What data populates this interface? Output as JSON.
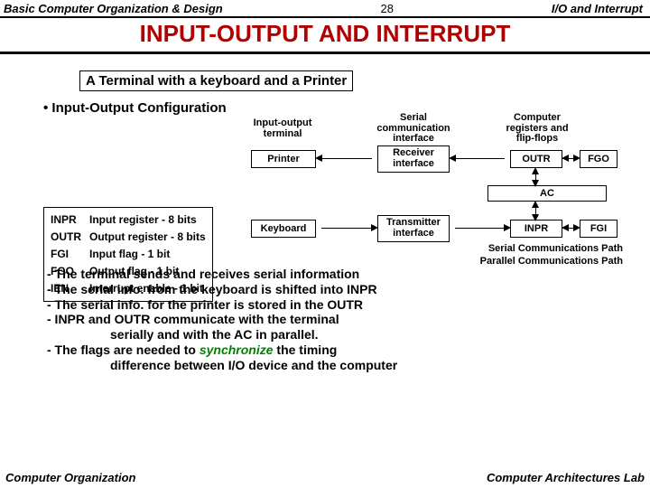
{
  "header": {
    "left": "Basic Computer Organization & Design",
    "num": "28",
    "right": "I/O and Interrupt"
  },
  "title": "INPUT-OUTPUT  AND  INTERRUPT",
  "subtitle": "A Terminal with a keyboard and a Printer",
  "bullet": "• Input-Output Configuration",
  "col_labels": {
    "io_terminal": "Input-output\nterminal",
    "serial_if": "Serial\ncommunication\ninterface",
    "regs": "Computer\nregisters and\nflip-flops"
  },
  "boxes": {
    "printer": "Printer",
    "keyboard": "Keyboard",
    "receiver_if": "Receiver\ninterface",
    "transmitter_if": "Transmitter\ninterface",
    "outr": "OUTR",
    "inpr": "INPR",
    "fgo": "FGO",
    "fgi": "FGI",
    "ac": "AC"
  },
  "reg_table": [
    [
      "INPR",
      "Input register - 8 bits"
    ],
    [
      "OUTR",
      "Output register - 8 bits"
    ],
    [
      "FGI",
      "Input flag - 1 bit"
    ],
    [
      "FGO",
      "Output flag - 1 bit"
    ],
    [
      "IEN",
      "Interrupt enable - 1 bit"
    ]
  ],
  "paths": {
    "serial": "Serial Communications Path",
    "parallel": "Parallel Communications Path"
  },
  "notes": {
    "l1": "- The terminal sends and receives serial information",
    "l2": "- The serial info. from the keyboard is shifted into INPR",
    "l3": "- The serial info. for the printer is stored in the OUTR",
    "l4": "- INPR and OUTR communicate with the terminal",
    "l4b": "serially and with the AC in parallel.",
    "l5a": "- The flags are needed to ",
    "l5b": "synchronize",
    "l5c": " the timing",
    "l5d": "difference between  I/O device and the computer"
  },
  "footer": {
    "left": "Computer Organization",
    "right": "Computer Architectures Lab"
  }
}
